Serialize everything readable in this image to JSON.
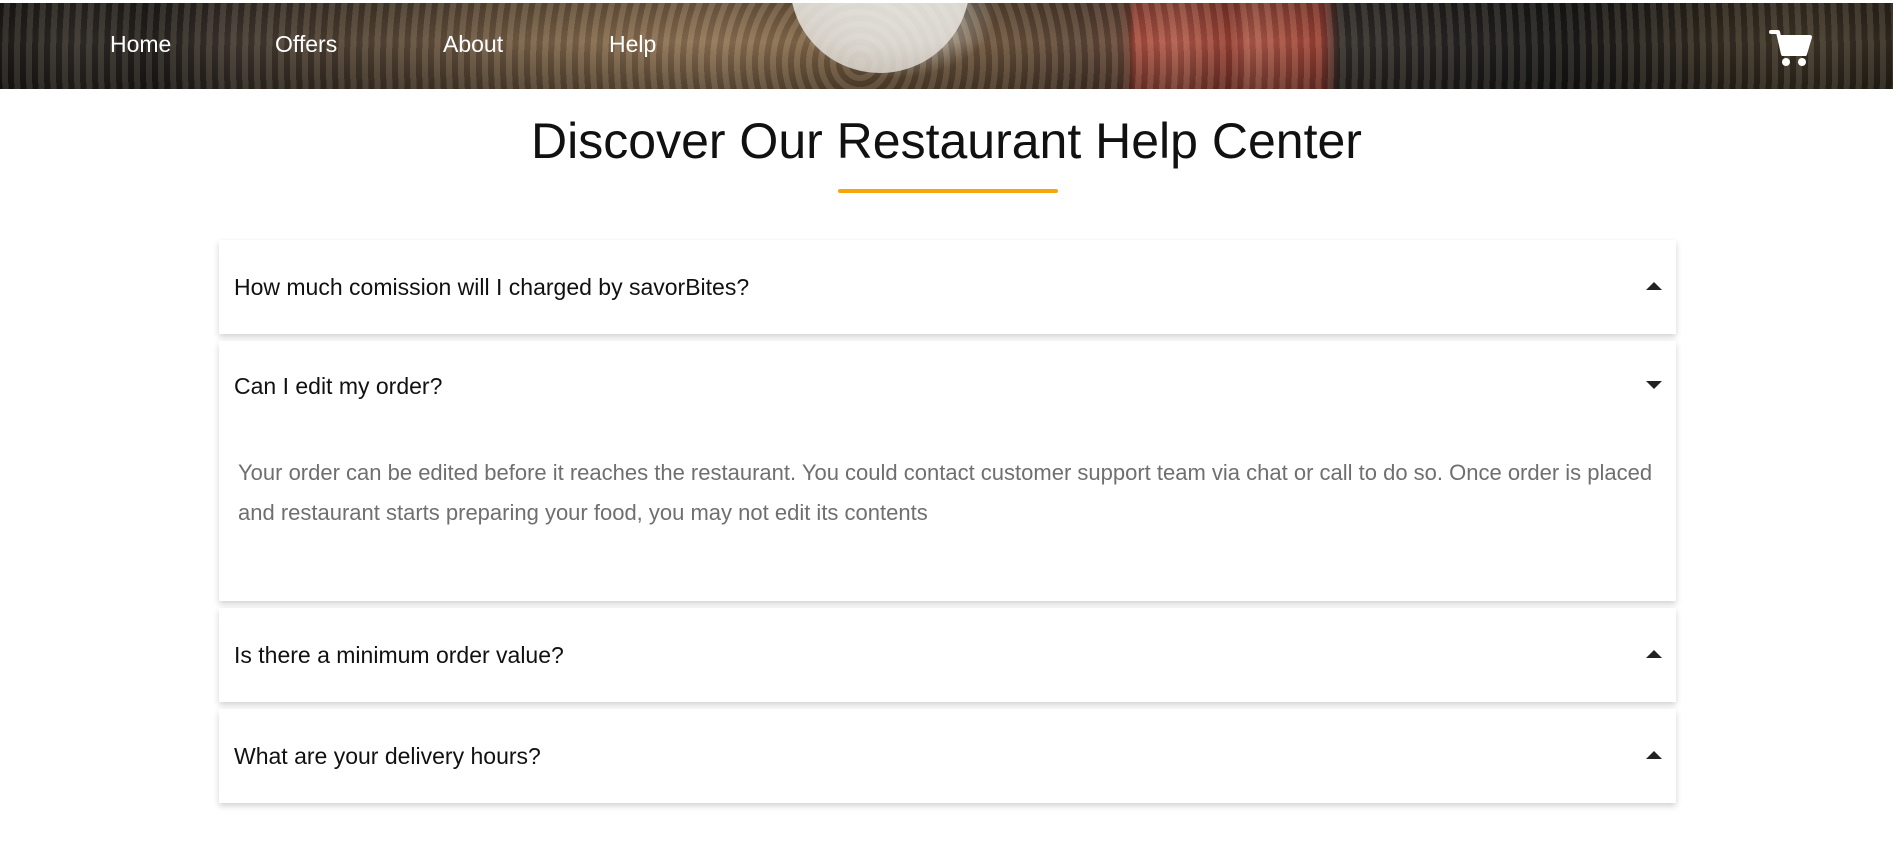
{
  "nav": {
    "items": [
      {
        "label": "Home"
      },
      {
        "label": "Offers"
      },
      {
        "label": "About"
      },
      {
        "label": "Help"
      }
    ],
    "cart_icon": "cart-icon"
  },
  "page": {
    "title": "Discover Our Restaurant Help Center",
    "accent_color": "#f5a60a"
  },
  "faq": [
    {
      "question": "How much comission will I charged by savorBites?",
      "expanded": false
    },
    {
      "question": "Can I edit my order?",
      "expanded": true,
      "answer": "Your order can be edited before it reaches the restaurant. You could contact customer support team via chat or call to do so. Once order is placed and restaurant starts preparing your food, you may not edit its contents"
    },
    {
      "question": "Is there a minimum order value?",
      "expanded": false
    },
    {
      "question": "What are your delivery hours?",
      "expanded": false
    }
  ]
}
